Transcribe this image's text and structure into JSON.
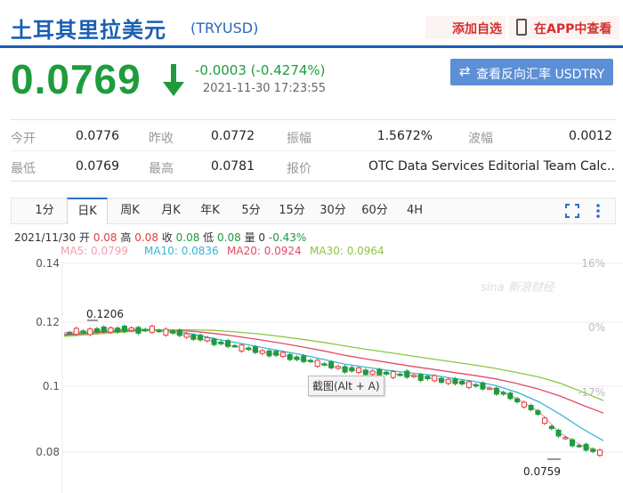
{
  "header": {
    "title": "土耳其里拉美元",
    "code": "(TRYUSD)",
    "add_fav": "添加自选",
    "in_app": "在APP中查看"
  },
  "quote": {
    "price": "0.0769",
    "change": "-0.0003 (-0.4274%)",
    "time": "2021-11-30 17:23:55",
    "reverse_label": "查看反向汇率 USDTRY"
  },
  "stats": {
    "row1": [
      {
        "label": "今开",
        "value": "0.0776"
      },
      {
        "label": "昨收",
        "value": "0.0772"
      },
      {
        "label": "振幅",
        "value": "1.5672%"
      },
      {
        "label": "波幅",
        "value": "0.0012"
      }
    ],
    "row2": [
      {
        "label": "最低",
        "value": "0.0769"
      },
      {
        "label": "最高",
        "value": "0.0781"
      },
      {
        "label": "报价",
        "value": "OTC Data Services Editorial Team Calc..."
      }
    ]
  },
  "tabs": [
    "1分",
    "日K",
    "周K",
    "月K",
    "年K",
    "5分",
    "15分",
    "30分",
    "60分",
    "4H"
  ],
  "active_tab": "日K",
  "ohlc": {
    "date": "2021/11/30",
    "open_label": "开",
    "open": "0.08",
    "high_label": "高",
    "high": "0.08",
    "close_label": "收",
    "close": "0.08",
    "low_label": "低",
    "low": "0.08",
    "vol_label": "量",
    "vol": "0",
    "pct": "-0.43%"
  },
  "ma": [
    {
      "label": "MA5: 0.0799",
      "color": "#f2a0b0"
    },
    {
      "label": "MA10: 0.0836",
      "color": "#3ab5d6"
    },
    {
      "label": "MA20: 0.0924",
      "color": "#e24a6a"
    },
    {
      "label": "MA30: 0.0964",
      "color": "#8cc63f"
    }
  ],
  "tooltip": "截图(Alt + A)",
  "watermark": "sina 新浪财经",
  "colors": {
    "up": "#e04040",
    "down": "#1e9c3c",
    "brand": "#1a5fb4"
  },
  "chart_data": {
    "type": "line",
    "y_ticks": [
      "0.14",
      "0.12",
      "0.1",
      "0.08"
    ],
    "right_ticks": [
      "16%",
      "0%",
      "-17%"
    ],
    "annotations": {
      "max": "0.1206",
      "min": "0.0759"
    },
    "ylim": [
      0.075,
      0.14
    ],
    "series": [
      {
        "name": "MA5",
        "values": [
          0.118,
          0.1185,
          0.119,
          0.119,
          0.1188,
          0.118,
          0.1165,
          0.115,
          0.1135,
          0.112,
          0.111,
          0.1095,
          0.108,
          0.1065,
          0.1055,
          0.105,
          0.1045,
          0.1035,
          0.1025,
          0.1015,
          0.1,
          0.097,
          0.093,
          0.086,
          0.082,
          0.08
        ]
      },
      {
        "name": "MA10",
        "values": [
          0.1175,
          0.118,
          0.1185,
          0.119,
          0.119,
          0.1185,
          0.1175,
          0.116,
          0.1148,
          0.1135,
          0.1122,
          0.111,
          0.1095,
          0.108,
          0.107,
          0.106,
          0.1052,
          0.1045,
          0.1035,
          0.1025,
          0.1012,
          0.099,
          0.096,
          0.092,
          0.0875,
          0.0836
        ]
      },
      {
        "name": "MA20",
        "values": [
          0.1172,
          0.1177,
          0.1182,
          0.1186,
          0.1189,
          0.1188,
          0.1184,
          0.1177,
          0.1168,
          0.1158,
          0.1147,
          0.1135,
          0.1122,
          0.1108,
          0.1096,
          0.1085,
          0.1074,
          0.1064,
          0.1054,
          0.1044,
          0.1033,
          0.1018,
          0.1,
          0.0978,
          0.095,
          0.0924
        ]
      },
      {
        "name": "MA30",
        "values": [
          0.1168,
          0.1173,
          0.1178,
          0.1183,
          0.1187,
          0.1189,
          0.1189,
          0.1187,
          0.1182,
          0.1176,
          0.1168,
          0.1159,
          0.1149,
          0.1138,
          0.1127,
          0.1117,
          0.1107,
          0.1097,
          0.1087,
          0.1077,
          0.1066,
          0.1053,
          0.1039,
          0.1019,
          0.0992,
          0.0964
        ]
      }
    ]
  }
}
